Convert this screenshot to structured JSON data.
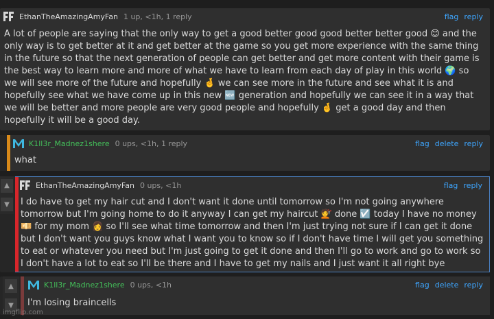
{
  "comments": [
    {
      "username": "EthanTheAmazingAmyFan",
      "meta": "1 up, <1h, 1 reply",
      "actions": [
        "flag",
        "reply"
      ],
      "username_color": "#dcdcdc",
      "text": "A lot of people are saying that the only way to get a good better good good better better good 😊 and the only way is to get better at it and get better at the game so you get more experience with the same thing in the future so that the next generation of people can get better and get more content with their game is the best way to learn more and more of what we have to learn from each day of play in this world 🌍 so we will see more of the future and hopefully 🤞 we can see more in the future and see what it is and hopefully see what we have come up in this new 🆕 generation and hopefully we can see it in a way that we will be better and more people are very good people and hopefully 🤞 get a good day and then hopefully it will be a good day."
    },
    {
      "username": "K1ll3r_Madnez1shere",
      "meta": "0 ups, <1h, 1 reply",
      "actions": [
        "flag",
        "delete",
        "reply"
      ],
      "username_color": "#44c05a",
      "bar_color": "#d98a1a",
      "text": "what"
    },
    {
      "username": "EthanTheAmazingAmyFan",
      "meta": "0 ups, <1h",
      "actions": [
        "flag",
        "reply"
      ],
      "username_color": "#dcdcdc",
      "bar_color": "#d8262b",
      "text": "I do have to get my hair cut and I don't want it done until tomorrow so I'm not going anywhere tomorrow but I'm going home to do it anyway I can get my haircut 💇 done ☑️ today I have no money 💴 for my mom 👩 so I'll see what time tomorrow and then I'm just trying not sure if I can get it done but I don't want you guys know what I want you to know so if I don't have time I will get you something to eat or whatever you need but I'm just going to get it done and then I'll go to work and go to work so I don't have a lot to eat so I'll be there and I have to get my nails and I just want it all right bye"
    },
    {
      "username": "K1ll3r_Madnez1shere",
      "meta": "0 ups, <1h",
      "actions": [
        "flag",
        "delete",
        "reply"
      ],
      "username_color": "#44c05a",
      "bar_color": "#7a3b3b",
      "text": "I'm losing braincells"
    }
  ],
  "watermark": "imgflip.com"
}
